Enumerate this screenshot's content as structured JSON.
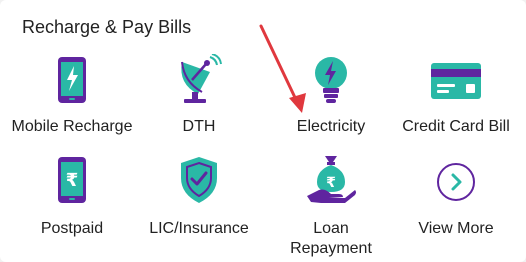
{
  "section": {
    "title": "Recharge & Pay Bills"
  },
  "items": [
    {
      "label": "Mobile Recharge",
      "icon": "mobile-charge-icon"
    },
    {
      "label": "DTH",
      "icon": "satellite-dish-icon"
    },
    {
      "label": "Electricity",
      "icon": "bulb-bolt-icon"
    },
    {
      "label": "Credit Card Bill",
      "icon": "credit-card-icon"
    },
    {
      "label": "Postpaid",
      "icon": "mobile-rupee-icon"
    },
    {
      "label": "LIC/Insurance",
      "icon": "shield-check-icon"
    },
    {
      "label": "Loan",
      "label2": "Repayment",
      "icon": "money-bag-hand-icon"
    },
    {
      "label": "View More",
      "icon": "chevron-right-circle-icon"
    }
  ],
  "colors": {
    "purple": "#5f259f",
    "teal": "#2ab8a6",
    "arrow": "#e0383e"
  }
}
